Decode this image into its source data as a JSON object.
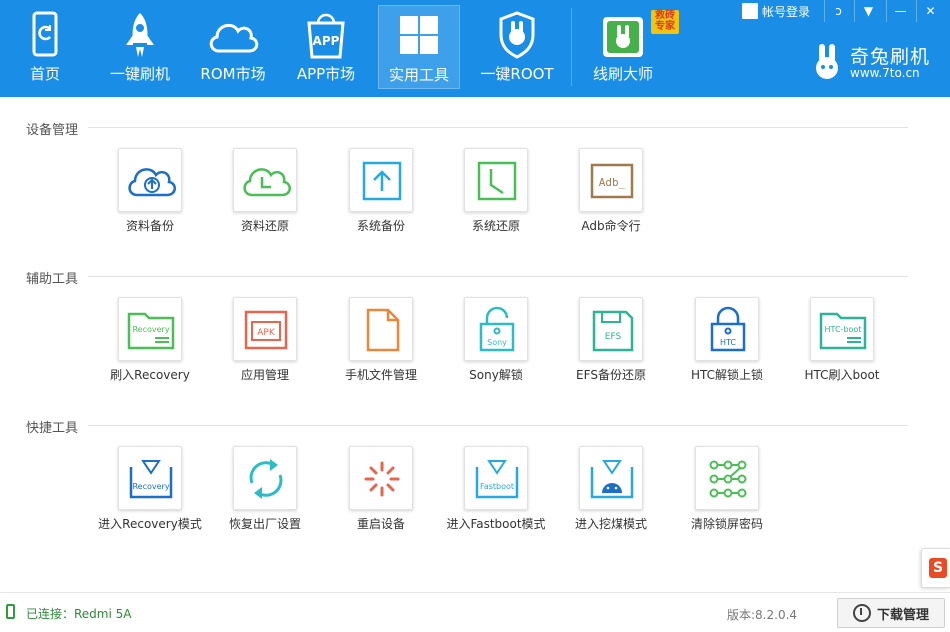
{
  "header": {
    "nav": [
      {
        "label": "首页"
      },
      {
        "label": "一键刷机"
      },
      {
        "label": "ROM市场"
      },
      {
        "label": "APP市场"
      },
      {
        "label": "实用工具"
      },
      {
        "label": "一键ROOT"
      },
      {
        "label": "线刷大师"
      }
    ],
    "app_icon_text": "APP",
    "badge_text": "救砖专家",
    "login_label": "帐号登录",
    "brand_name": "奇兔刷机",
    "brand_url": "www.7to.cn",
    "active_tab": "实用工具"
  },
  "sections": [
    {
      "title": "设备管理",
      "tools": [
        {
          "label": "资料备份"
        },
        {
          "label": "资料还原"
        },
        {
          "label": "系统备份"
        },
        {
          "label": "系统还原"
        },
        {
          "label": "Adb命令行",
          "icon_text": "Adb_"
        }
      ]
    },
    {
      "title": "辅助工具",
      "tools": [
        {
          "label": "刷入Recovery",
          "icon_text": "Recovery"
        },
        {
          "label": "应用管理",
          "icon_text": "APK"
        },
        {
          "label": "手机文件管理"
        },
        {
          "label": "Sony解锁",
          "icon_text": "Sony"
        },
        {
          "label": "EFS备份还原",
          "icon_text": "EFS"
        },
        {
          "label": "HTC解锁上锁",
          "icon_text": "HTC"
        },
        {
          "label": "HTC刷入boot",
          "icon_text": "HTC-boot"
        }
      ]
    },
    {
      "title": "快捷工具",
      "tools": [
        {
          "label": "进入Recovery模式",
          "icon_text": "Recovery"
        },
        {
          "label": "恢复出厂设置"
        },
        {
          "label": "重启设备"
        },
        {
          "label": "进入Fastboot模式",
          "icon_text": "Fastboot"
        },
        {
          "label": "进入挖煤模式"
        },
        {
          "label": "清除锁屏密码"
        }
      ]
    }
  ],
  "status": {
    "connection": "已连接：Redmi 5A",
    "version": "版本:8.2.0.4",
    "download_label": "下载管理"
  },
  "side_widget_text": "S",
  "colors": {
    "header_bg": "#1a8ee6",
    "blue": "#1b6fc9",
    "green": "#4bbf55",
    "cyan": "#26a9e0",
    "brown": "#a07a4e",
    "red": "#e8644e",
    "orange": "#e8883a",
    "teal": "#2bbcc6"
  }
}
